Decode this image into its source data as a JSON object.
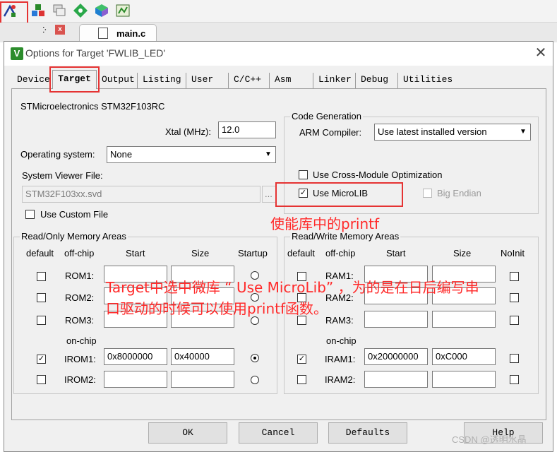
{
  "ide": {
    "file_tab": "main.c",
    "pin_glyph": "ⴾ",
    "close_glyph": "x"
  },
  "dialog": {
    "title": "Options for Target 'FWLIB_LED'",
    "app_icon": "V",
    "close_glyph": "✕"
  },
  "tabs": [
    "Device",
    "Target",
    "Output",
    "Listing",
    "User",
    "C/C++",
    "Asm",
    "Linker",
    "Debug",
    "Utilities"
  ],
  "target": {
    "device_name": "STMicroelectronics STM32F103RC",
    "xtal_label": "Xtal (MHz):",
    "xtal_value": "12.0",
    "os_label": "Operating system:",
    "os_value": "None",
    "viewer_label": "System Viewer File:",
    "viewer_value": "STM32F103xx.svd",
    "browse_label": "...",
    "use_custom_file": "Use Custom File",
    "code_gen_title": "Code Generation",
    "arm_compiler_label": "ARM Compiler:",
    "arm_compiler_value": "Use latest installed version",
    "cross_module": "Use Cross-Module Optimization",
    "use_microlib": "Use MicroLIB",
    "big_endian": "Big Endian"
  },
  "ro_memory": {
    "title": "Read/Only Memory Areas",
    "headers": [
      "default",
      "off-chip",
      "Start",
      "Size",
      "Startup"
    ],
    "on_chip_label": "on-chip",
    "rows": [
      {
        "name": "ROM1:",
        "start": "",
        "size": "",
        "default": false,
        "startup": false
      },
      {
        "name": "ROM2:",
        "start": "",
        "size": "",
        "default": false,
        "startup": false
      },
      {
        "name": "ROM3:",
        "start": "",
        "size": "",
        "default": false,
        "startup": false
      },
      {
        "name": "IROM1:",
        "start": "0x8000000",
        "size": "0x40000",
        "default": true,
        "startup": true
      },
      {
        "name": "IROM2:",
        "start": "",
        "size": "",
        "default": false,
        "startup": false
      }
    ]
  },
  "rw_memory": {
    "title": "Read/Write Memory Areas",
    "headers": [
      "default",
      "off-chip",
      "Start",
      "Size",
      "NoInit"
    ],
    "on_chip_label": "on-chip",
    "rows": [
      {
        "name": "RAM1:",
        "start": "",
        "size": "",
        "default": false,
        "noinit": false
      },
      {
        "name": "RAM2:",
        "start": "",
        "size": "",
        "default": false,
        "noinit": false
      },
      {
        "name": "RAM3:",
        "start": "",
        "size": "",
        "default": false,
        "noinit": false
      },
      {
        "name": "IRAM1:",
        "start": "0x20000000",
        "size": "0xC000",
        "default": true,
        "noinit": false
      },
      {
        "name": "IRAM2:",
        "start": "",
        "size": "",
        "default": false,
        "noinit": false
      }
    ]
  },
  "buttons": {
    "ok": "OK",
    "cancel": "Cancel",
    "defaults": "Defaults",
    "help": "Help"
  },
  "annotations": {
    "microlib_note": "使能库中的printf",
    "target_note_line1": "Target中选中微库 “ Use MicroLib” ，为的是在日后编写串",
    "target_note_line2": "口驱动的时候可以使用printf函数。"
  },
  "watermark": "CSDN @透明水晶",
  "colors": {
    "annotation_red": "#e53333",
    "text_red": "#ff2a2a"
  }
}
